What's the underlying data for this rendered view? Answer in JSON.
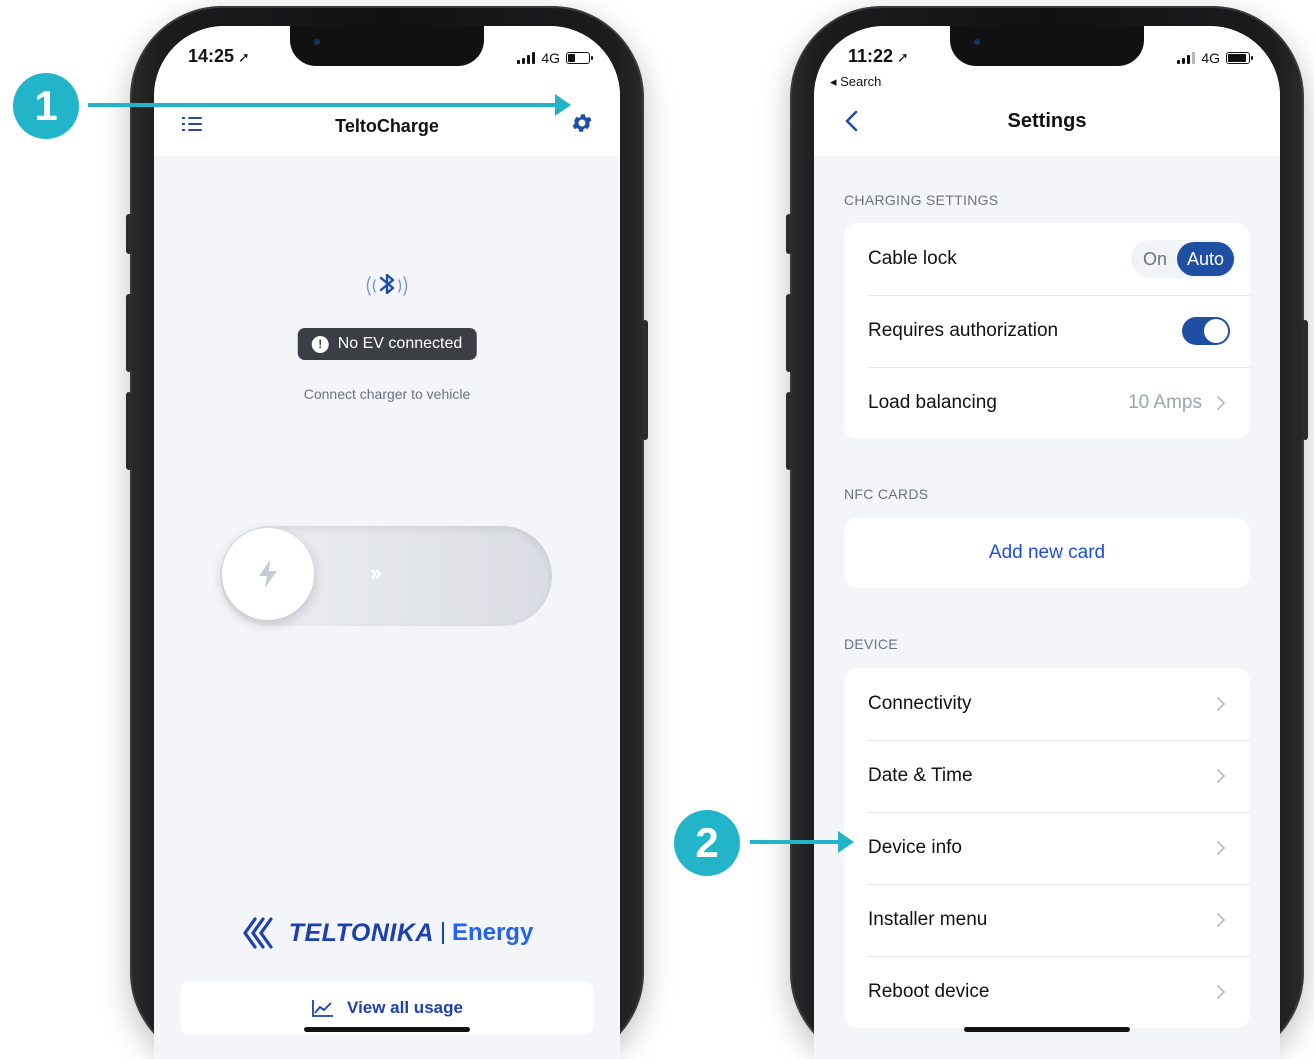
{
  "left_phone": {
    "status": {
      "time": "14:25",
      "network": "4G"
    },
    "header": {
      "title": "TeltoCharge"
    },
    "ev_status": {
      "label": "No EV connected",
      "hint": "Connect charger to vehicle"
    },
    "slider": {
      "chevrons": "››"
    },
    "brand": {
      "logo": "TELTONIKA",
      "product": "Energy"
    },
    "usage_button": {
      "label": "View all usage"
    }
  },
  "right_phone": {
    "status": {
      "time": "11:22",
      "network": "4G",
      "back_app": "◂ Search"
    },
    "header": {
      "title": "Settings"
    },
    "charging": {
      "section_label": "CHARGING SETTINGS",
      "cable_lock": {
        "label": "Cable lock",
        "options": [
          "On",
          "Auto"
        ],
        "selected": "Auto"
      },
      "requires_auth": {
        "label": "Requires authorization",
        "enabled": true
      },
      "load_balancing": {
        "label": "Load balancing",
        "value": "10 Amps"
      }
    },
    "nfc": {
      "section_label": "NFC CARDS",
      "add_label": "Add new card"
    },
    "device": {
      "section_label": "DEVICE",
      "items": [
        "Connectivity",
        "Date & Time",
        "Device info",
        "Installer menu",
        "Reboot device"
      ]
    }
  },
  "annotations": {
    "step1": "1",
    "step2": "2"
  },
  "colors": {
    "accent": "#1e4fa3",
    "annotation": "#22b5c9",
    "brand": "#1e40af"
  }
}
